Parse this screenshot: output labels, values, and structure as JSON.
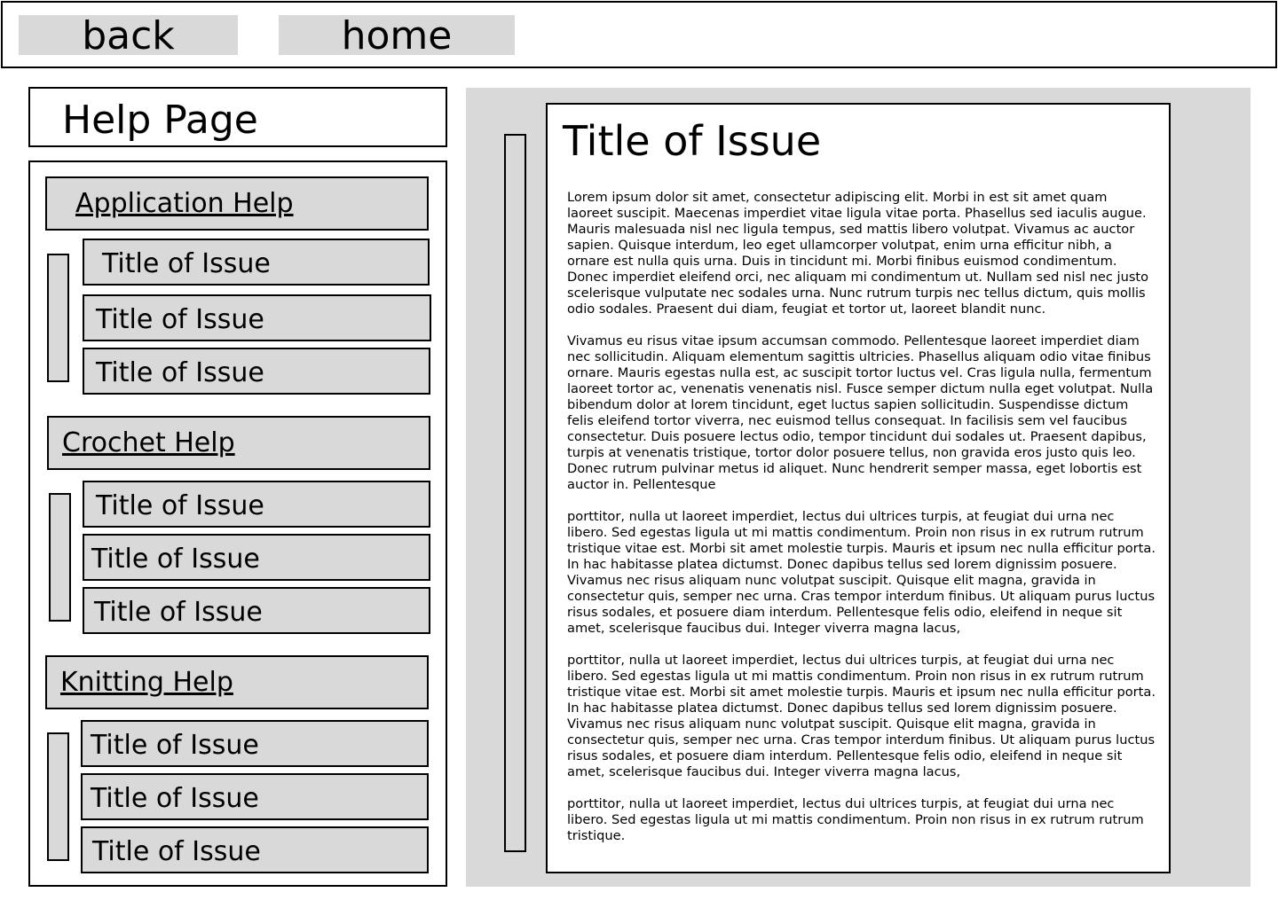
{
  "nav": {
    "back_label": "back",
    "home_label": "home"
  },
  "sidebar": {
    "page_title": "Help Page",
    "categories": [
      {
        "label": "Application Help",
        "issues": [
          "Title of Issue",
          "Title of Issue",
          "Title of Issue"
        ]
      },
      {
        "label": "Crochet Help",
        "issues": [
          "Title of Issue",
          "Title of Issue",
          "Title of Issue"
        ]
      },
      {
        "label": "Knitting Help",
        "issues": [
          "Title of Issue",
          "Title of Issue",
          "Title of Issue"
        ]
      }
    ]
  },
  "article": {
    "title": "Title of Issue",
    "paragraphs": [
      "Lorem ipsum dolor sit amet, consectetur adipiscing elit. Morbi in est sit amet quam laoreet suscipit. Maecenas imperdiet vitae ligula vitae porta. Phasellus sed iaculis augue. Mauris malesuada nisl nec ligula tempus, sed mattis libero volutpat. Vivamus ac auctor sapien. Quisque interdum, leo eget ullamcorper volutpat, enim urna efficitur nibh, a ornare est nulla quis urna. Duis in tincidunt mi. Morbi finibus euismod condimentum. Donec imperdiet eleifend orci, nec aliquam mi condimentum ut. Nullam sed nisl nec justo scelerisque vulputate nec sodales urna. Nunc rutrum turpis nec tellus dictum, quis mollis odio sodales. Praesent dui diam, feugiat et tortor ut, laoreet blandit nunc.",
      "Vivamus eu risus vitae ipsum accumsan commodo. Pellentesque laoreet imperdiet diam nec sollicitudin. Aliquam elementum sagittis ultricies. Phasellus aliquam odio vitae finibus ornare. Mauris egestas nulla est, ac suscipit tortor luctus vel. Cras ligula nulla, fermentum laoreet tortor ac, venenatis venenatis nisl. Fusce semper dictum nulla eget volutpat. Nulla bibendum dolor at lorem tincidunt, eget luctus sapien sollicitudin. Suspendisse dictum felis eleifend tortor viverra, nec euismod tellus consequat. In facilisis sem vel faucibus consectetur. Duis posuere lectus odio, tempor tincidunt dui sodales ut. Praesent dapibus, turpis at venenatis tristique, tortor dolor posuere tellus, non gravida eros justo quis leo. Donec rutrum pulvinar metus id aliquet. Nunc hendrerit semper massa, eget lobortis est auctor in. Pellentesque",
      "porttitor, nulla ut laoreet imperdiet, lectus dui ultrices turpis, at feugiat dui urna nec libero. Sed egestas ligula ut mi mattis condimentum. Proin non risus in ex rutrum rutrum tristique vitae est. Morbi sit amet molestie turpis. Mauris et ipsum nec nulla efficitur porta. In hac habitasse platea dictumst. Donec dapibus tellus sed lorem dignissim posuere. Vivamus nec risus aliquam nunc volutpat suscipit. Quisque elit magna, gravida in consectetur quis, semper nec urna. Cras tempor interdum finibus. Ut aliquam purus luctus risus sodales, et posuere diam interdum. Pellentesque felis odio, eleifend in neque sit amet, scelerisque faucibus dui. Integer viverra magna lacus,",
      "porttitor, nulla ut laoreet imperdiet, lectus dui ultrices turpis, at feugiat dui urna nec libero. Sed egestas ligula ut mi mattis condimentum. Proin non risus in ex rutrum rutrum tristique vitae est. Morbi sit amet molestie turpis. Mauris et ipsum nec nulla efficitur porta. In hac habitasse platea dictumst. Donec dapibus tellus sed lorem dignissim posuere. Vivamus nec risus aliquam nunc volutpat suscipit. Quisque elit magna, gravida in consectetur quis, semper nec urna. Cras tempor interdum finibus. Ut aliquam purus luctus risus sodales, et posuere diam interdum. Pellentesque felis odio, eleifend in neque sit amet, scelerisque faucibus dui. Integer viverra magna lacus,",
      "porttitor, nulla ut laoreet imperdiet, lectus dui ultrices turpis, at feugiat dui urna nec libero. Sed egestas ligula ut mi mattis condimentum. Proin non risus in ex rutrum rutrum tristique."
    ]
  }
}
